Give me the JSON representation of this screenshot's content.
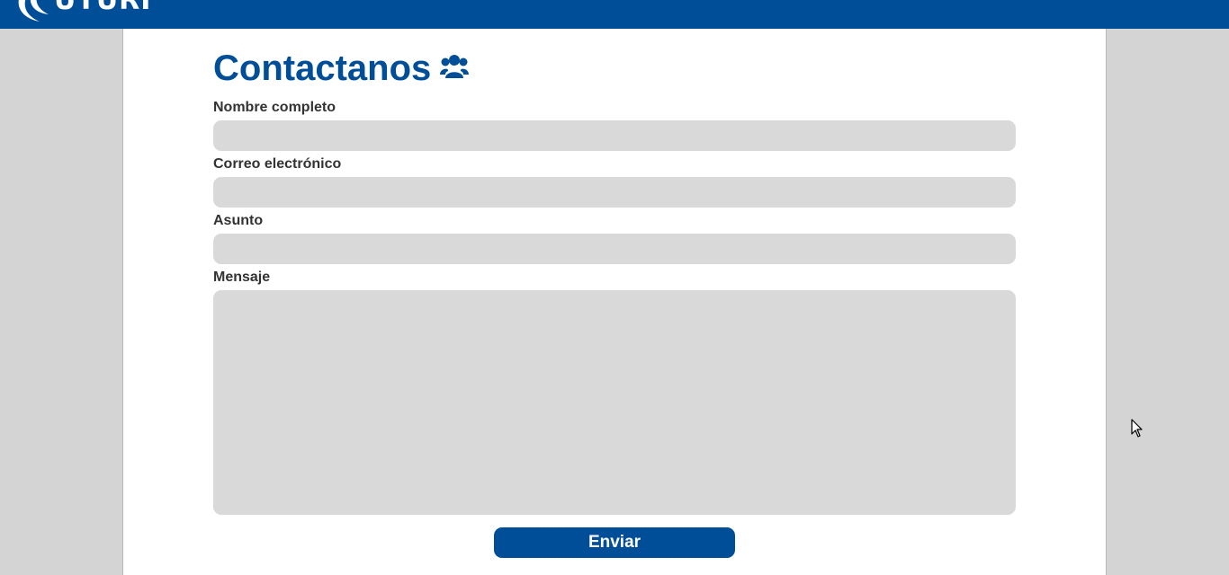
{
  "header": {
    "logo_text": "UTURI",
    "logo_icon": "swoosh-logo-icon"
  },
  "contact": {
    "title": "Contactanos",
    "title_icon": "users-icon",
    "fields": {
      "name_label": "Nombre completo",
      "name_value": "",
      "email_label": "Correo electrónico",
      "email_value": "",
      "subject_label": "Asunto",
      "subject_value": "",
      "message_label": "Mensaje",
      "message_value": ""
    },
    "submit_label": "Enviar"
  },
  "colors": {
    "brand_blue": "#014e98",
    "field_bg": "#d9d9d9",
    "page_bg": "#d4d4d4"
  }
}
